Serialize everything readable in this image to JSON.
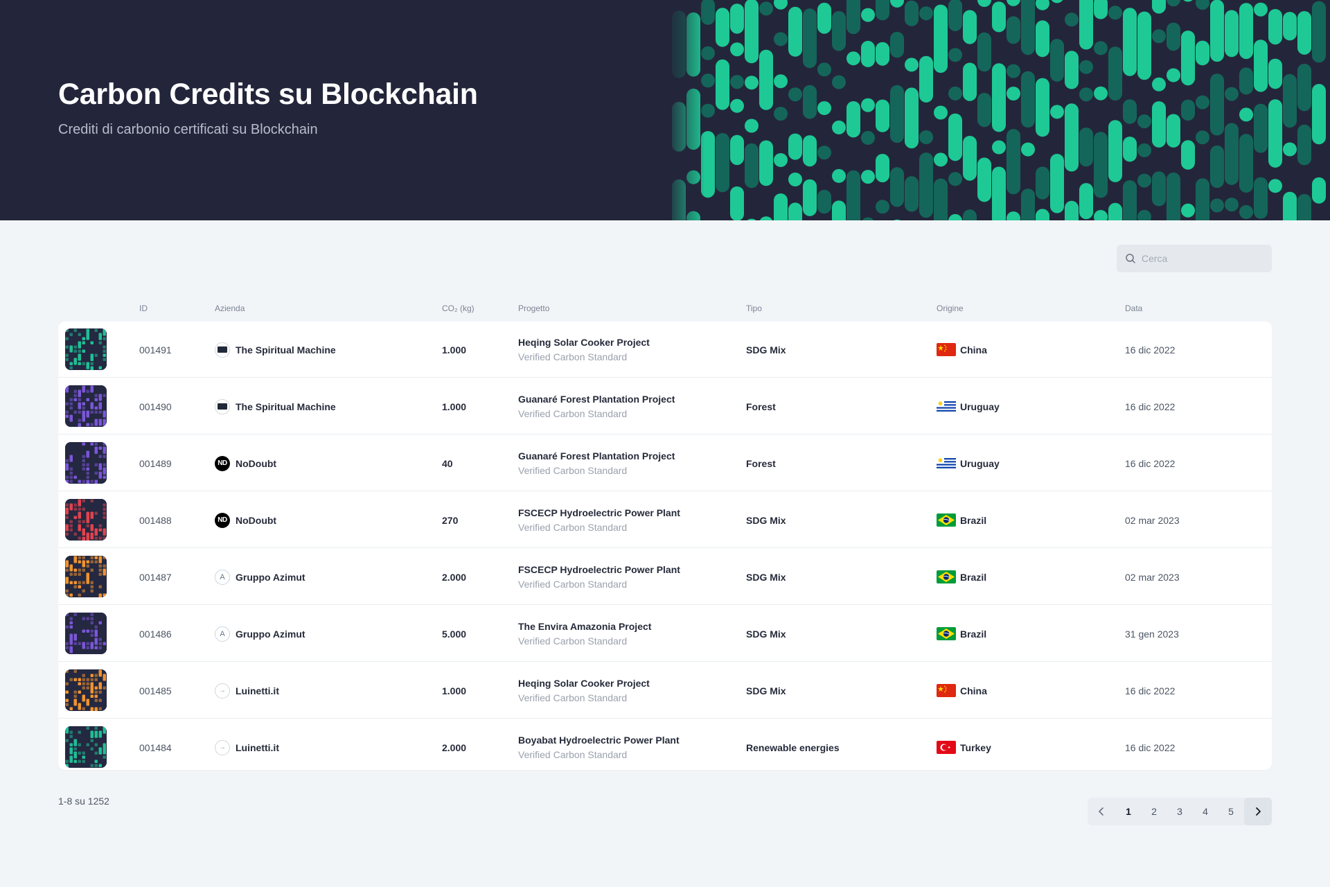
{
  "hero": {
    "title": "Carbon Credits su Blockchain",
    "subtitle": "Crediti di carbonio certificati su Blockchain",
    "accent_colors": [
      "#1ec995",
      "#15665a"
    ]
  },
  "search": {
    "placeholder": "Cerca",
    "icon": "search-icon"
  },
  "table": {
    "columns": [
      "ID",
      "Azienda",
      "CO₂ (kg)",
      "Progetto",
      "Tipo",
      "Origine",
      "Data"
    ],
    "rows": [
      {
        "id": "001491",
        "company": "The Spiritual Machine",
        "company_logo": "spiritual",
        "co2": "1.000",
        "project": "Heqing Solar Cooker Project",
        "standard": "Verified Carbon Standard",
        "type": "SDG Mix",
        "origin": "China",
        "flag": "cn",
        "date": "16 dic 2022",
        "thumb_color": "#1fbf95"
      },
      {
        "id": "001490",
        "company": "The Spiritual Machine",
        "company_logo": "spiritual",
        "co2": "1.000",
        "project": "Guanaré Forest Plantation Project",
        "standard": "Verified Carbon Standard",
        "type": "Forest",
        "origin": "Uruguay",
        "flag": "uy",
        "date": "16 dic 2022",
        "thumb_color": "#7b56d9"
      },
      {
        "id": "001489",
        "company": "NoDoubt",
        "company_logo": "nodoubt",
        "co2": "40",
        "project": "Guanaré Forest Plantation Project",
        "standard": "Verified Carbon Standard",
        "type": "Forest",
        "origin": "Uruguay",
        "flag": "uy",
        "date": "16 dic 2022",
        "thumb_color": "#7b56d9"
      },
      {
        "id": "001488",
        "company": "NoDoubt",
        "company_logo": "nodoubt",
        "co2": "270",
        "project": "FSCECP Hydroelectric Power Plant",
        "standard": "Verified Carbon Standard",
        "type": "SDG Mix",
        "origin": "Brazil",
        "flag": "br",
        "date": "02 mar 2023",
        "thumb_color": "#e0434f"
      },
      {
        "id": "001487",
        "company": "Gruppo Azimut",
        "company_logo": "azimut",
        "co2": "2.000",
        "project": "FSCECP Hydroelectric Power Plant",
        "standard": "Verified Carbon Standard",
        "type": "SDG Mix",
        "origin": "Brazil",
        "flag": "br",
        "date": "02 mar 2023",
        "thumb_color": "#f0932f"
      },
      {
        "id": "001486",
        "company": "Gruppo Azimut",
        "company_logo": "azimut",
        "co2": "5.000",
        "project": "The Envira Amazonia Project",
        "standard": "Verified Carbon Standard",
        "type": "SDG Mix",
        "origin": "Brazil",
        "flag": "br",
        "date": "31 gen 2023",
        "thumb_color": "#7b56d9"
      },
      {
        "id": "001485",
        "company": "Luinetti.it",
        "company_logo": "luinetti",
        "co2": "1.000",
        "project": "Heqing Solar Cooker Project",
        "standard": "Verified Carbon Standard",
        "type": "SDG Mix",
        "origin": "China",
        "flag": "cn",
        "date": "16 dic 2022",
        "thumb_color": "#f0932f"
      },
      {
        "id": "001484",
        "company": "Luinetti.it",
        "company_logo": "luinetti",
        "co2": "2.000",
        "project": "Boyabat Hydroelectric Power Plant",
        "standard": "Verified Carbon Standard",
        "type": "Renewable energies",
        "origin": "Turkey",
        "flag": "tr",
        "date": "16 dic 2022",
        "thumb_color": "#1fbf95"
      }
    ]
  },
  "footer": {
    "count": "1-8 su 1252",
    "pages": [
      "1",
      "2",
      "3",
      "4",
      "5"
    ],
    "current_page": "1"
  }
}
